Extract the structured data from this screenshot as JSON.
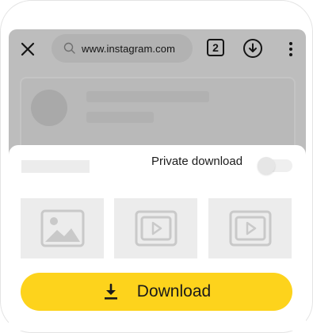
{
  "browser": {
    "url": "www.instagram.com",
    "tab_count": "2"
  },
  "sheet": {
    "private_download_label": "Private download",
    "private_download_enabled": false,
    "thumbnails": [
      {
        "type": "image"
      },
      {
        "type": "video"
      },
      {
        "type": "video"
      }
    ],
    "download_label": "Download"
  },
  "colors": {
    "accent": "#fdd31c",
    "overlay": "#bdbdbd"
  },
  "icons": [
    "close-icon",
    "search-icon",
    "tabs-icon",
    "download-icon",
    "more-vert-icon",
    "image-icon",
    "play-icon"
  ]
}
